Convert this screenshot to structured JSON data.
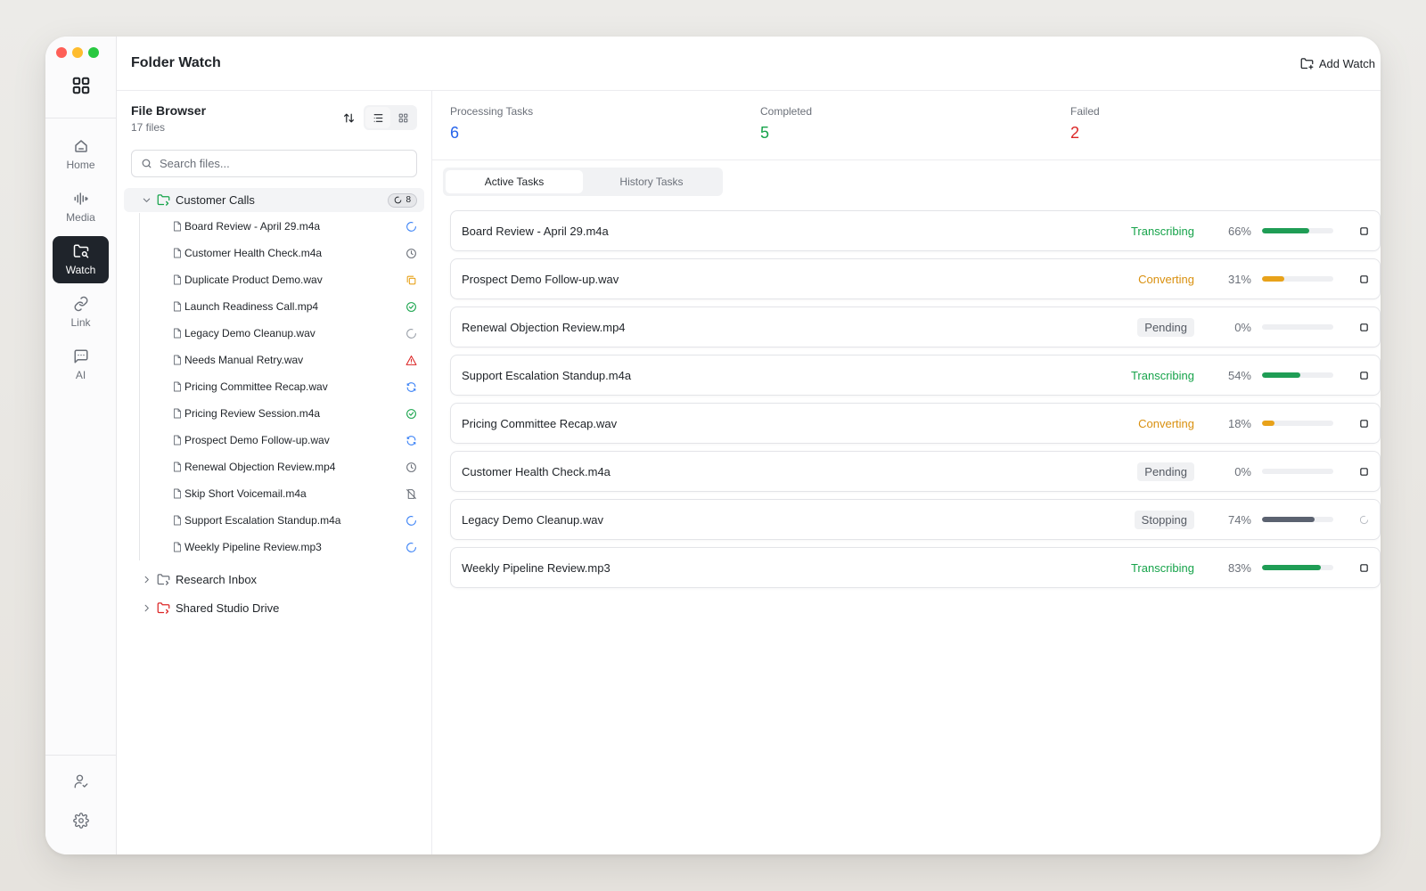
{
  "header": {
    "title": "Folder Watch",
    "add_watch_label": "Add Watch"
  },
  "rail": {
    "items": [
      {
        "label": "Home",
        "icon": "home-icon",
        "active": false
      },
      {
        "label": "Media",
        "icon": "waveform-icon",
        "active": false
      },
      {
        "label": "Watch",
        "icon": "folder-search-icon",
        "active": true
      },
      {
        "label": "Link",
        "icon": "link-icon",
        "active": false
      },
      {
        "label": "AI",
        "icon": "chat-icon",
        "active": false
      }
    ],
    "bottom": [
      "user-check-icon",
      "gear-icon"
    ]
  },
  "browser": {
    "title": "File Browser",
    "count": "17 files",
    "search_placeholder": "Search files...",
    "folders": [
      {
        "name": "Customer Calls",
        "badge": "8",
        "open": true,
        "files": [
          {
            "name": "Board Review - April 29.m4a",
            "status": "processing"
          },
          {
            "name": "Customer Health Check.m4a",
            "status": "pending"
          },
          {
            "name": "Duplicate Product Demo.wav",
            "status": "duplicate"
          },
          {
            "name": "Launch Readiness Call.mp4",
            "status": "done"
          },
          {
            "name": "Legacy Demo Cleanup.wav",
            "status": "stopping"
          },
          {
            "name": "Needs Manual Retry.wav",
            "status": "failed"
          },
          {
            "name": "Pricing Committee Recap.wav",
            "status": "converting"
          },
          {
            "name": "Pricing Review Session.m4a",
            "status": "done"
          },
          {
            "name": "Prospect Demo Follow-up.wav",
            "status": "converting"
          },
          {
            "name": "Renewal Objection Review.mp4",
            "status": "pending"
          },
          {
            "name": "Skip Short Voicemail.m4a",
            "status": "skipped"
          },
          {
            "name": "Support Escalation Standup.m4a",
            "status": "processing"
          },
          {
            "name": "Weekly Pipeline Review.mp3",
            "status": "processing"
          }
        ]
      },
      {
        "name": "Research Inbox",
        "open": false,
        "color": "#6b7079"
      },
      {
        "name": "Shared Studio Drive",
        "open": false,
        "color": "#dc2626"
      }
    ]
  },
  "stats": [
    {
      "label": "Processing Tasks",
      "value": "6",
      "color": "#2563eb"
    },
    {
      "label": "Completed",
      "value": "5",
      "color": "#16a34a"
    },
    {
      "label": "Failed",
      "value": "2",
      "color": "#dc2626"
    }
  ],
  "tabs": [
    "Active Tasks",
    "History Tasks"
  ],
  "tasks": [
    {
      "name": "Board Review - April 29.m4a",
      "status": "Transcribing",
      "kind": "transcribing",
      "pct": "66%",
      "progress": 0.66
    },
    {
      "name": "Prospect Demo Follow-up.wav",
      "status": "Converting",
      "kind": "converting",
      "pct": "31%",
      "progress": 0.31
    },
    {
      "name": "Renewal Objection Review.mp4",
      "status": "Pending",
      "kind": "pending",
      "pct": "0%",
      "progress": 0
    },
    {
      "name": "Support Escalation Standup.m4a",
      "status": "Transcribing",
      "kind": "transcribing",
      "pct": "54%",
      "progress": 0.54
    },
    {
      "name": "Pricing Committee Recap.wav",
      "status": "Converting",
      "kind": "converting",
      "pct": "18%",
      "progress": 0.18
    },
    {
      "name": "Customer Health Check.m4a",
      "status": "Pending",
      "kind": "pending",
      "pct": "0%",
      "progress": 0
    },
    {
      "name": "Legacy Demo Cleanup.wav",
      "status": "Stopping",
      "kind": "stopping",
      "pct": "74%",
      "progress": 0.74
    },
    {
      "name": "Weekly Pipeline Review.mp3",
      "status": "Transcribing",
      "kind": "transcribing",
      "pct": "83%",
      "progress": 0.83
    }
  ],
  "colors": {
    "transcribing": "#16a34a",
    "converting": "#d9900f",
    "pending": "#555a63",
    "stopping": "#555a63",
    "bar_transcribing": "#1f9d55",
    "bar_converting": "#e8a21a",
    "bar_stopping": "#5b6270",
    "processing_icon": "#3b82f6",
    "done_icon": "#16a34a",
    "failed_icon": "#dc2626",
    "duplicate_icon": "#e8a21a",
    "folder_active": "#16a34a"
  }
}
